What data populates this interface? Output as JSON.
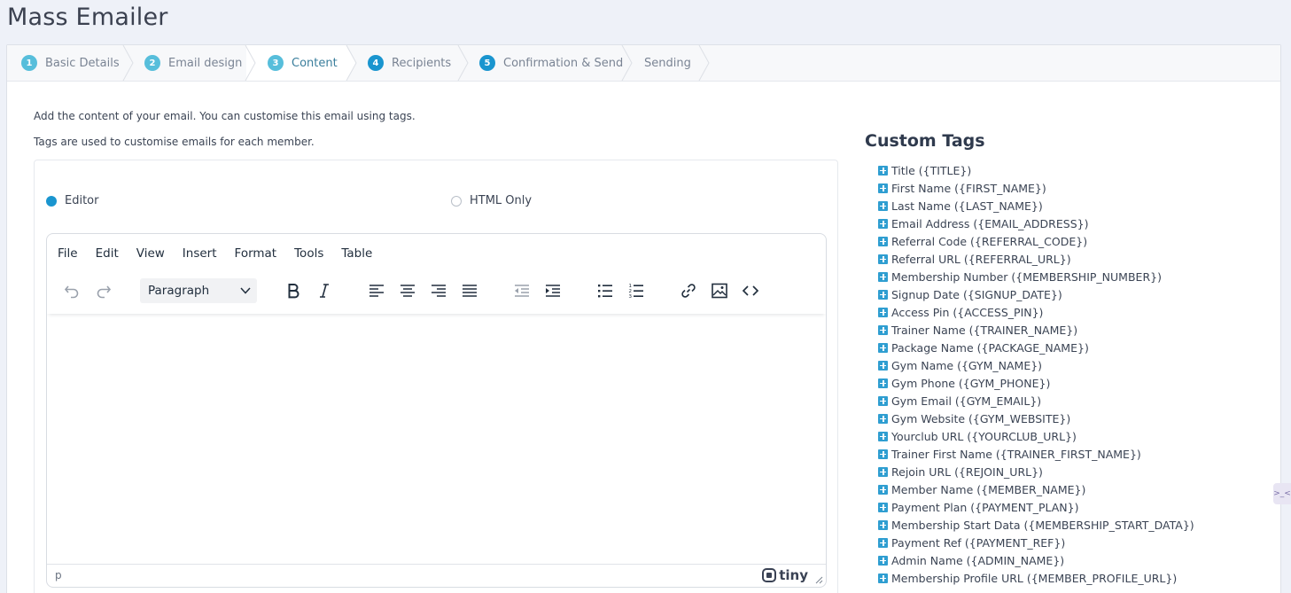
{
  "app": {
    "title": "Mass Emailer"
  },
  "wizard": {
    "steps": [
      {
        "num": "1",
        "label": "Basic Details"
      },
      {
        "num": "2",
        "label": "Email design"
      },
      {
        "num": "3",
        "label": "Content"
      },
      {
        "num": "4",
        "label": "Recipients"
      },
      {
        "num": "5",
        "label": "Confirmation & Send"
      },
      {
        "num": "",
        "label": "Sending"
      }
    ],
    "active_step": "Content"
  },
  "intro": {
    "line1": "Add the content of your email. You can customise this email using tags.",
    "line2": "Tags are used to customise emails for each member."
  },
  "mode": {
    "editor_label": "Editor",
    "html_label": "HTML Only",
    "selected": "Editor"
  },
  "editor": {
    "menu": [
      "File",
      "Edit",
      "View",
      "Insert",
      "Format",
      "Tools",
      "Table"
    ],
    "format_select": "Paragraph",
    "status_path": "p",
    "brand": "tiny",
    "content": ""
  },
  "custom_tags": {
    "title": "Custom Tags",
    "items": [
      "Title ({TITLE})",
      "First Name ({FIRST_NAME})",
      "Last Name ({LAST_NAME})",
      "Email Address ({EMAIL_ADDRESS})",
      "Referral Code ({REFERRAL_CODE})",
      "Referral URL ({REFERRAL_URL})",
      "Membership Number ({MEMBERSHIP_NUMBER})",
      "Signup Date ({SIGNUP_DATE})",
      "Access Pin ({ACCESS_PIN})",
      "Trainer Name ({TRAINER_NAME})",
      "Package Name ({PACKAGE_NAME})",
      "Gym Name ({GYM_NAME})",
      "Gym Phone ({GYM_PHONE})",
      "Gym Email ({GYM_EMAIL})",
      "Gym Website ({GYM_WEBSITE})",
      "Yourclub URL ({YOURCLUB_URL})",
      "Trainer First Name ({TRAINER_FIRST_NAME})",
      "Rejoin URL ({REJOIN_URL})",
      "Member Name ({MEMBER_NAME})",
      "Payment Plan ({PAYMENT_PLAN})",
      "Membership Start Data ({MEMBERSHIP_START_DATA})",
      "Payment Ref ({PAYMENT_REF})",
      "Admin Name ({ADMIN_NAME})",
      "Membership Profile URL ({MEMBER_PROFILE_URL})"
    ]
  },
  "side_widget": {
    "label": ">_<"
  },
  "colors": {
    "accent": "#1a95cf",
    "step_light": "#57bedb",
    "tag_icon": "#2f9ed1",
    "background": "#eef1f8"
  }
}
